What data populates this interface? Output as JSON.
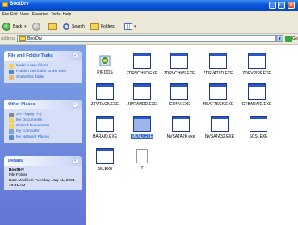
{
  "window": {
    "title": "BootDrv"
  },
  "menu": [
    "File",
    "Edit",
    "View",
    "Favorites",
    "Tools",
    "Help"
  ],
  "toolbar": {
    "back_label": "Back",
    "search_label": "Search",
    "folders_label": "Folders"
  },
  "address": {
    "label": "Address",
    "value": "BootDrv",
    "go_label": "Go"
  },
  "tasks": {
    "title": "File and Folder Tasks",
    "items": [
      "Make a new folder",
      "Publish this folder to the Web",
      "Share this folder"
    ]
  },
  "places": {
    "title": "Other Places",
    "items": [
      "3½ Floppy (A:)",
      "My Documents",
      "Shared Documents",
      "My Computer",
      "My Network Places"
    ]
  },
  "details": {
    "title": "Details",
    "name": "BootDrv",
    "type": "File Folder",
    "modified": "Date Modified: Tuesday, May 11, 2004, 10:41 AM"
  },
  "files": [
    {
      "name": "PIF.DOS",
      "icon": "settings-icon"
    },
    {
      "name": "ZDRVCHLD.EXE",
      "icon": "exe-icon"
    },
    {
      "name": "ZDRVCHKS.EXE",
      "icon": "exe-icon"
    },
    {
      "name": "ZDRVATLD.EXE",
      "icon": "exe-icon"
    },
    {
      "name": "ZDRVPIPF.EXE",
      "icon": "exe-icon"
    },
    {
      "name": "ZIPATACK.EXE",
      "icon": "exe-icon"
    },
    {
      "name": "ZIPRANDD.EXE",
      "icon": "exe-icon"
    },
    {
      "name": "ICONV.EXE",
      "icon": "exe-icon"
    },
    {
      "name": "MSAFTSCK.EXE",
      "icon": "exe-icon"
    },
    {
      "name": "GTBARAID.EXE",
      "icon": "exe-icon"
    },
    {
      "name": "HARAID.EXE",
      "icon": "exe-icon"
    },
    {
      "name": "MENU.EXE",
      "icon": "exe-icon",
      "selected": true
    },
    {
      "name": "NVSATA2K.exe",
      "icon": "exe-icon"
    },
    {
      "name": "NVSATA32.EXE",
      "icon": "exe-icon"
    },
    {
      "name": "SCSI.EXE",
      "icon": "exe-icon"
    },
    {
      "name": "SIL.EXE",
      "icon": "exe-icon"
    },
    {
      "name": "T",
      "icon": "document-icon"
    }
  ]
}
